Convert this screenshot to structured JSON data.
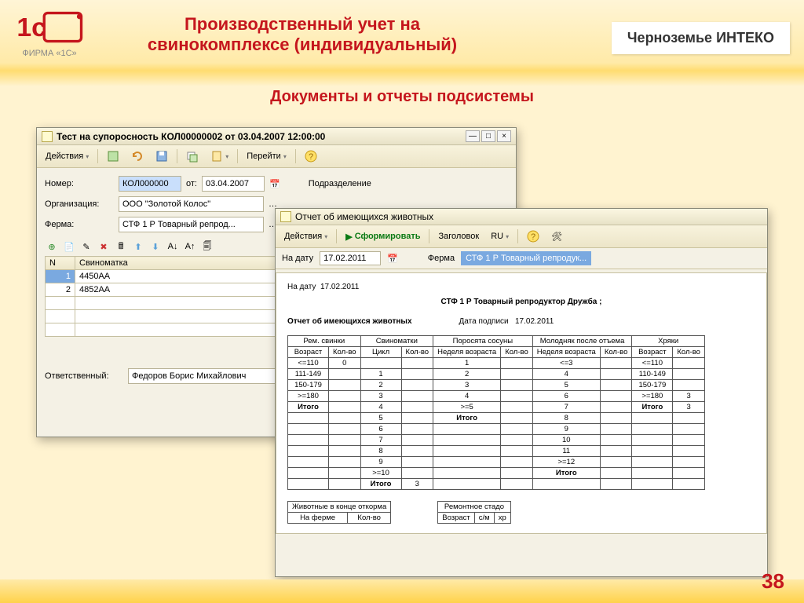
{
  "slide": {
    "title1": "Производственный учет на",
    "title2": "свинокомплексе (индивидуальный)",
    "company": "Черноземье ИНТЕКО",
    "section": "Документы и отчеты подсистемы",
    "logo_sub": "ФИРМА «1С»",
    "page": "38"
  },
  "win1": {
    "title": "Тест на супоросность КОЛ00000002 от 03.04.2007 12:00:00",
    "actions": "Действия",
    "goto": "Перейти",
    "lbl_num": "Номер:",
    "val_num": "КОЛ000000",
    "lbl_from": "от:",
    "val_from": "03.04.2007",
    "lbl_org": "Организация:",
    "val_org": "ООО \"Золотой Колос\"",
    "lbl_dept": "Подразделение",
    "lbl_farm": "Ферма:",
    "val_farm": "СТФ 1 Р Товарный репрод...",
    "col_n": "N",
    "col_pig": "Свиноматка",
    "rows": [
      {
        "n": "1",
        "pig": "4450AA"
      },
      {
        "n": "2",
        "pig": "4852AA"
      }
    ],
    "lbl_resp": "Ответственный:",
    "val_resp": "Федоров Борис Михайлович"
  },
  "win2": {
    "title": "Отчет об имеющихся животных",
    "actions": "Действия",
    "run": "Сформировать",
    "hdr": "Заголовок",
    "lang": "RU",
    "lbl_date": "На дату",
    "val_date": "17.02.2011",
    "lbl_farm": "Ферма",
    "val_farm": "СТФ 1 Р Товарный репродук...",
    "rpt_date_lbl": "На дату",
    "rpt_date": "17.02.2011",
    "rpt_farm_line": "СТФ 1 Р Товарный репродуктор Дружба ;",
    "rpt_title": "Отчет об имеющихся животных",
    "sign_date_lbl": "Дата подписи",
    "sign_date": "17.02.2011",
    "groups": [
      "Рем. свинки",
      "Свиноматки",
      "Поросята сосуны",
      "Молодняк после отъема",
      "Хряки"
    ],
    "sub": {
      "age": "Возраст",
      "qty": "Кол-во",
      "cycle": "Цикл",
      "week": "Неделя возраста"
    },
    "total": "Итого",
    "sec2a": "Животные в конце откорма",
    "sec2b": "Ремонтное стадо",
    "sec2_cols": {
      "onfarm": "На ферме",
      "qty": "Кол-во",
      "age": "Возраст",
      "sm": "с/м",
      "xp": "хр"
    }
  },
  "chart_data": {
    "type": "table",
    "title": "Отчет об имеющихся животных — СТФ 1 Р Товарный репродуктор Дружба",
    "as_of": "17.02.2011",
    "columns": [
      "Рем. свинки / Возраст",
      "Рем. свинки / Кол-во",
      "Свиноматки / Цикл",
      "Свиноматки / Кол-во",
      "Поросята сосуны / Неделя возраста",
      "Поросята сосуны / Кол-во",
      "Молодняк после отъема / Неделя возраста",
      "Молодняк после отъема / Кол-во",
      "Хряки / Возраст",
      "Хряки / Кол-во"
    ],
    "rows": [
      [
        "<=110",
        "0",
        "",
        "",
        "1",
        "",
        "<=3",
        "",
        "<=110",
        ""
      ],
      [
        "111-149",
        "",
        "1",
        "",
        "2",
        "",
        "4",
        "",
        "110-149",
        ""
      ],
      [
        "150-179",
        "",
        "2",
        "",
        "3",
        "",
        "5",
        "",
        "150-179",
        ""
      ],
      [
        ">=180",
        "",
        "3",
        "",
        "4",
        "",
        "6",
        "",
        ">=180",
        "3"
      ],
      [
        "Итого",
        "",
        "4",
        "",
        ">=5",
        "",
        "7",
        "",
        "Итого",
        "3"
      ],
      [
        "",
        "",
        "5",
        "",
        "Итого",
        "",
        "8",
        "",
        "",
        ""
      ],
      [
        "",
        "",
        "6",
        "",
        "",
        "",
        "9",
        "",
        "",
        ""
      ],
      [
        "",
        "",
        "7",
        "",
        "",
        "",
        "10",
        "",
        "",
        ""
      ],
      [
        "",
        "",
        "8",
        "",
        "",
        "",
        "11",
        "",
        "",
        ""
      ],
      [
        "",
        "",
        "9",
        "",
        "",
        "",
        ">=12",
        "",
        "",
        ""
      ],
      [
        "",
        "",
        ">=10",
        "",
        "",
        "",
        "Итого",
        "",
        "",
        ""
      ],
      [
        "",
        "",
        "Итого",
        "3",
        "",
        "",
        "",
        "",
        "",
        ""
      ]
    ]
  }
}
